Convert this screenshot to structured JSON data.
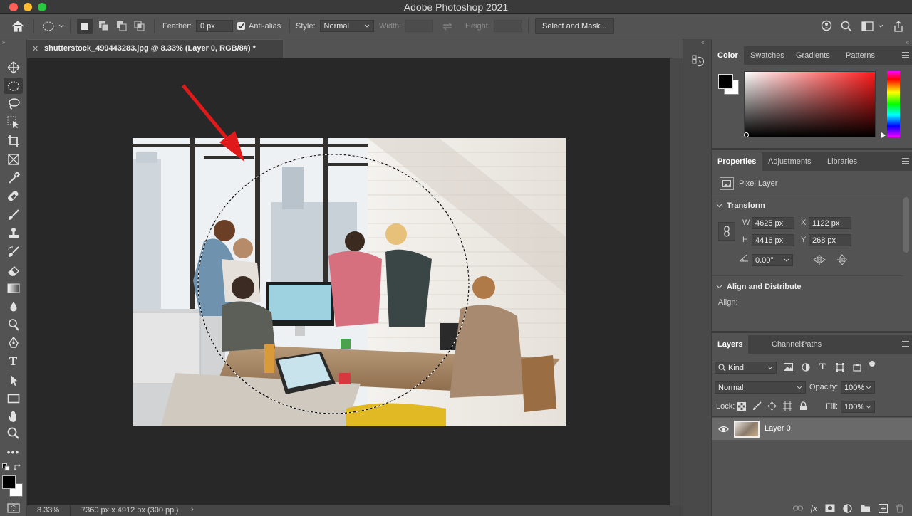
{
  "app": {
    "title": "Adobe Photoshop 2021"
  },
  "options": {
    "feather_label": "Feather:",
    "feather_value": "0 px",
    "antialias_label": "Anti-alias",
    "style_label": "Style:",
    "style_value": "Normal",
    "width_label": "Width:",
    "height_label": "Height:",
    "select_mask": "Select and Mask..."
  },
  "document": {
    "tab_title": "shutterstock_499443283.jpg @ 8.33% (Layer 0, RGB/8#) *",
    "zoom": "8.33%",
    "dims": "7360 px x 4912 px (300 ppi)"
  },
  "color_panel": {
    "tabs": [
      "Color",
      "Swatches",
      "Gradients",
      "Patterns"
    ],
    "foreground": "#000000",
    "background": "#ffffff",
    "hue": "#ff1a1a"
  },
  "properties": {
    "tabs": [
      "Properties",
      "Adjustments",
      "Libraries"
    ],
    "layer_type": "Pixel Layer",
    "transform": "Transform",
    "w_label": "W",
    "w": "4625 px",
    "x_label": "X",
    "x": "1122 px",
    "h_label": "H",
    "h": "4416 px",
    "y_label": "Y",
    "y": "268 px",
    "angle": "0.00°",
    "align_header": "Align and Distribute",
    "align_label": "Align:"
  },
  "layers": {
    "tabs": [
      "Layers",
      "Channels",
      "Paths"
    ],
    "filter": "Kind",
    "blend": "Normal",
    "opacity_label": "Opacity:",
    "opacity": "100%",
    "lock_label": "Lock:",
    "fill_label": "Fill:",
    "fill": "100%",
    "layer_name": "Layer 0"
  },
  "icons": [
    "home-icon",
    "ellipse-marquee-icon",
    "move-icon",
    "lasso-icon",
    "crop-icon",
    "eyedropper-icon",
    "brush-icon",
    "stamp-icon",
    "eraser-icon",
    "gradient-icon",
    "pen-icon",
    "type-icon",
    "hand-icon",
    "zoom-icon",
    "search-icon",
    "eye-icon"
  ],
  "colors": {
    "accent_arrow": "#e01a1a"
  }
}
